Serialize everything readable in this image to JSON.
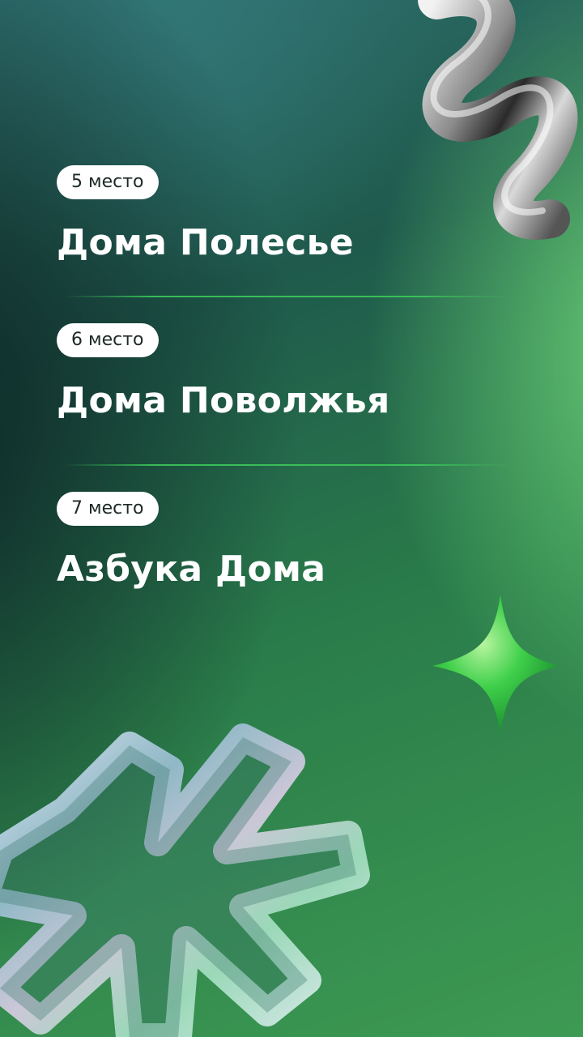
{
  "entries": [
    {
      "rank": "5 место",
      "name": "Дома Полесье"
    },
    {
      "rank": "6 место",
      "name": "Дома Поволжья"
    },
    {
      "rank": "7 место",
      "name": "Азбука Дома"
    }
  ],
  "colors": {
    "badge_bg": "#ffffff",
    "title": "#ffffff",
    "accent_green": "#3cc85a"
  },
  "decorations": [
    "chrome-spiral-icon",
    "green-star-icon",
    "glass-asterisk-icon"
  ]
}
